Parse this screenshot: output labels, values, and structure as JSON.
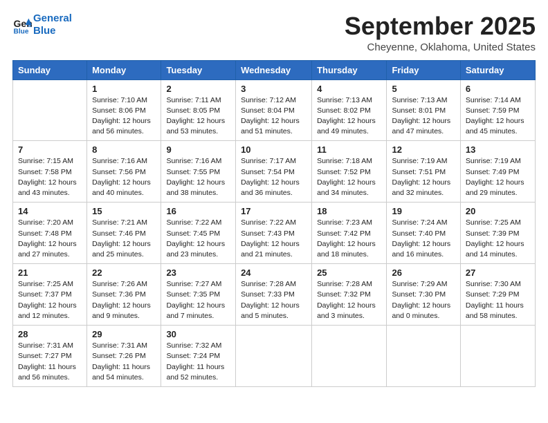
{
  "header": {
    "logo_line1": "General",
    "logo_line2": "Blue",
    "month": "September 2025",
    "location": "Cheyenne, Oklahoma, United States"
  },
  "weekdays": [
    "Sunday",
    "Monday",
    "Tuesday",
    "Wednesday",
    "Thursday",
    "Friday",
    "Saturday"
  ],
  "weeks": [
    [
      {
        "day": "",
        "info": ""
      },
      {
        "day": "1",
        "info": "Sunrise: 7:10 AM\nSunset: 8:06 PM\nDaylight: 12 hours\nand 56 minutes."
      },
      {
        "day": "2",
        "info": "Sunrise: 7:11 AM\nSunset: 8:05 PM\nDaylight: 12 hours\nand 53 minutes."
      },
      {
        "day": "3",
        "info": "Sunrise: 7:12 AM\nSunset: 8:04 PM\nDaylight: 12 hours\nand 51 minutes."
      },
      {
        "day": "4",
        "info": "Sunrise: 7:13 AM\nSunset: 8:02 PM\nDaylight: 12 hours\nand 49 minutes."
      },
      {
        "day": "5",
        "info": "Sunrise: 7:13 AM\nSunset: 8:01 PM\nDaylight: 12 hours\nand 47 minutes."
      },
      {
        "day": "6",
        "info": "Sunrise: 7:14 AM\nSunset: 7:59 PM\nDaylight: 12 hours\nand 45 minutes."
      }
    ],
    [
      {
        "day": "7",
        "info": "Sunrise: 7:15 AM\nSunset: 7:58 PM\nDaylight: 12 hours\nand 43 minutes."
      },
      {
        "day": "8",
        "info": "Sunrise: 7:16 AM\nSunset: 7:56 PM\nDaylight: 12 hours\nand 40 minutes."
      },
      {
        "day": "9",
        "info": "Sunrise: 7:16 AM\nSunset: 7:55 PM\nDaylight: 12 hours\nand 38 minutes."
      },
      {
        "day": "10",
        "info": "Sunrise: 7:17 AM\nSunset: 7:54 PM\nDaylight: 12 hours\nand 36 minutes."
      },
      {
        "day": "11",
        "info": "Sunrise: 7:18 AM\nSunset: 7:52 PM\nDaylight: 12 hours\nand 34 minutes."
      },
      {
        "day": "12",
        "info": "Sunrise: 7:19 AM\nSunset: 7:51 PM\nDaylight: 12 hours\nand 32 minutes."
      },
      {
        "day": "13",
        "info": "Sunrise: 7:19 AM\nSunset: 7:49 PM\nDaylight: 12 hours\nand 29 minutes."
      }
    ],
    [
      {
        "day": "14",
        "info": "Sunrise: 7:20 AM\nSunset: 7:48 PM\nDaylight: 12 hours\nand 27 minutes."
      },
      {
        "day": "15",
        "info": "Sunrise: 7:21 AM\nSunset: 7:46 PM\nDaylight: 12 hours\nand 25 minutes."
      },
      {
        "day": "16",
        "info": "Sunrise: 7:22 AM\nSunset: 7:45 PM\nDaylight: 12 hours\nand 23 minutes."
      },
      {
        "day": "17",
        "info": "Sunrise: 7:22 AM\nSunset: 7:43 PM\nDaylight: 12 hours\nand 21 minutes."
      },
      {
        "day": "18",
        "info": "Sunrise: 7:23 AM\nSunset: 7:42 PM\nDaylight: 12 hours\nand 18 minutes."
      },
      {
        "day": "19",
        "info": "Sunrise: 7:24 AM\nSunset: 7:40 PM\nDaylight: 12 hours\nand 16 minutes."
      },
      {
        "day": "20",
        "info": "Sunrise: 7:25 AM\nSunset: 7:39 PM\nDaylight: 12 hours\nand 14 minutes."
      }
    ],
    [
      {
        "day": "21",
        "info": "Sunrise: 7:25 AM\nSunset: 7:37 PM\nDaylight: 12 hours\nand 12 minutes."
      },
      {
        "day": "22",
        "info": "Sunrise: 7:26 AM\nSunset: 7:36 PM\nDaylight: 12 hours\nand 9 minutes."
      },
      {
        "day": "23",
        "info": "Sunrise: 7:27 AM\nSunset: 7:35 PM\nDaylight: 12 hours\nand 7 minutes."
      },
      {
        "day": "24",
        "info": "Sunrise: 7:28 AM\nSunset: 7:33 PM\nDaylight: 12 hours\nand 5 minutes."
      },
      {
        "day": "25",
        "info": "Sunrise: 7:28 AM\nSunset: 7:32 PM\nDaylight: 12 hours\nand 3 minutes."
      },
      {
        "day": "26",
        "info": "Sunrise: 7:29 AM\nSunset: 7:30 PM\nDaylight: 12 hours\nand 0 minutes."
      },
      {
        "day": "27",
        "info": "Sunrise: 7:30 AM\nSunset: 7:29 PM\nDaylight: 11 hours\nand 58 minutes."
      }
    ],
    [
      {
        "day": "28",
        "info": "Sunrise: 7:31 AM\nSunset: 7:27 PM\nDaylight: 11 hours\nand 56 minutes."
      },
      {
        "day": "29",
        "info": "Sunrise: 7:31 AM\nSunset: 7:26 PM\nDaylight: 11 hours\nand 54 minutes."
      },
      {
        "day": "30",
        "info": "Sunrise: 7:32 AM\nSunset: 7:24 PM\nDaylight: 11 hours\nand 52 minutes."
      },
      {
        "day": "",
        "info": ""
      },
      {
        "day": "",
        "info": ""
      },
      {
        "day": "",
        "info": ""
      },
      {
        "day": "",
        "info": ""
      }
    ]
  ]
}
